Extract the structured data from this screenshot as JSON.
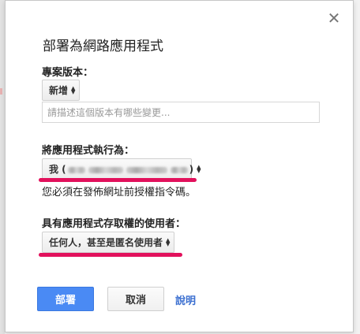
{
  "dialog": {
    "title": "部署為網路應用程式",
    "close_icon": "close-icon"
  },
  "version": {
    "label": "專案版本：",
    "selected": "新增",
    "description_placeholder": "請描述這個版本有哪些變更..."
  },
  "execute_as": {
    "label": "將應用程式執行為：",
    "selected_prefix": "我 (",
    "selected_suffix": ")",
    "hint": "您必須在發佈網址前授權指令碼。"
  },
  "access": {
    "label": "具有應用程式存取權的使用者：",
    "selected": "任何人，甚至是匿名使用者"
  },
  "actions": {
    "deploy": "部署",
    "cancel": "取消",
    "help": "說明"
  },
  "colors": {
    "primary": "#4a8af4",
    "highlight": "#e2115c",
    "link": "#3b6fd0"
  }
}
